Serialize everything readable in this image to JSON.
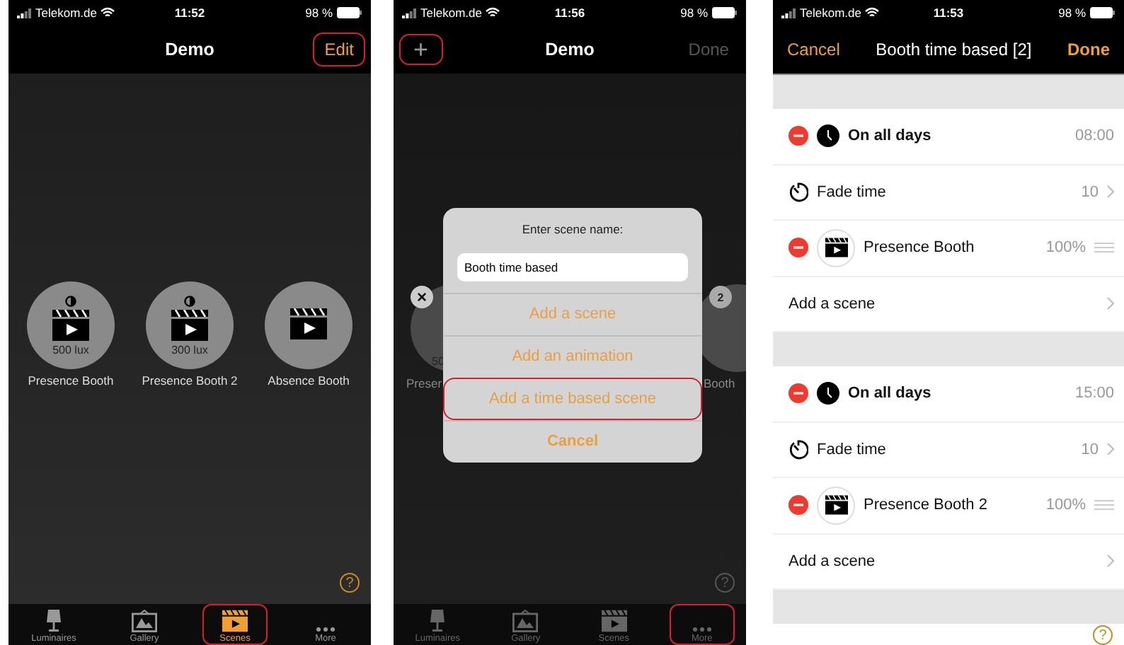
{
  "screen_1": {
    "status": {
      "carrier": "Telekom.de",
      "time": "11:52",
      "battery": "98 %"
    },
    "title": "Demo",
    "edit_button": {
      "label": "Edit",
      "highlighted": true
    },
    "scenes": [
      {
        "name": "Presence Booth",
        "lux": "500 lux"
      },
      {
        "name": "Presence Booth 2",
        "lux": "300 lux"
      },
      {
        "name": "Absence Booth"
      }
    ],
    "help": "?",
    "tab_bar": [
      {
        "label": "Luminaires",
        "kind": "lamp",
        "selected": false,
        "highlighted": false
      },
      {
        "label": "Gallery",
        "kind": "gallery",
        "selected": false,
        "highlighted": false
      },
      {
        "label": "Scenes",
        "kind": "scenes",
        "selected": true,
        "highlighted": true
      },
      {
        "label": "More",
        "kind": "more",
        "selected": false,
        "highlighted": false
      }
    ]
  },
  "screen_2": {
    "status": {
      "carrier": "Telekom.de",
      "time": "11:56",
      "battery": "98 %"
    },
    "add_button": {
      "label": "+",
      "highlighted": true
    },
    "title": "Demo",
    "done_button": {
      "label": "Done",
      "disabled": true
    },
    "background": {
      "left_name": "Preser",
      "left_lux": "50",
      "delete_mark": "×",
      "right_badge": "2",
      "right_name": "Booth"
    },
    "dialog": {
      "title": "Enter scene name:",
      "field_value": "Booth time based",
      "options": [
        {
          "label": "Add a scene",
          "kind": "action",
          "highlighted": false
        },
        {
          "label": "Add an animation",
          "kind": "action",
          "highlighted": false
        },
        {
          "label": "Add a time based scene",
          "kind": "action",
          "highlighted": true
        },
        {
          "label": "Cancel",
          "kind": "cancel",
          "highlighted": false
        }
      ]
    },
    "help": "?",
    "tab_bar": [
      {
        "label": "Luminaires",
        "kind": "lamp",
        "selected": false,
        "highlighted": false
      },
      {
        "label": "Gallery",
        "kind": "gallery",
        "selected": false,
        "highlighted": false
      },
      {
        "label": "Scenes",
        "kind": "scenes",
        "selected": false,
        "highlighted": false
      },
      {
        "label": "More",
        "kind": "more",
        "selected": false,
        "highlighted": true
      }
    ]
  },
  "screen_3": {
    "status": {
      "carrier": "Telekom.de",
      "time": "11:53",
      "battery": "98 %"
    },
    "cancel_button": "Cancel",
    "title": "Booth time based [2]",
    "done_button": "Done",
    "sections": [
      {
        "rows": [
          {
            "kind": "schedule",
            "label": "On all days",
            "value": "08:00"
          },
          {
            "kind": "fade",
            "label": "Fade time",
            "value": "10"
          },
          {
            "kind": "scene",
            "label": "Presence Booth",
            "value": "100%"
          },
          {
            "kind": "add",
            "label": "Add a scene"
          }
        ]
      },
      {
        "rows": [
          {
            "kind": "schedule",
            "label": "On all days",
            "value": "15:00"
          },
          {
            "kind": "fade",
            "label": "Fade time",
            "value": "10"
          },
          {
            "kind": "scene",
            "label": "Presence Booth 2",
            "value": "100%"
          },
          {
            "kind": "add",
            "label": "Add a scene"
          }
        ]
      }
    ],
    "help": "?"
  }
}
